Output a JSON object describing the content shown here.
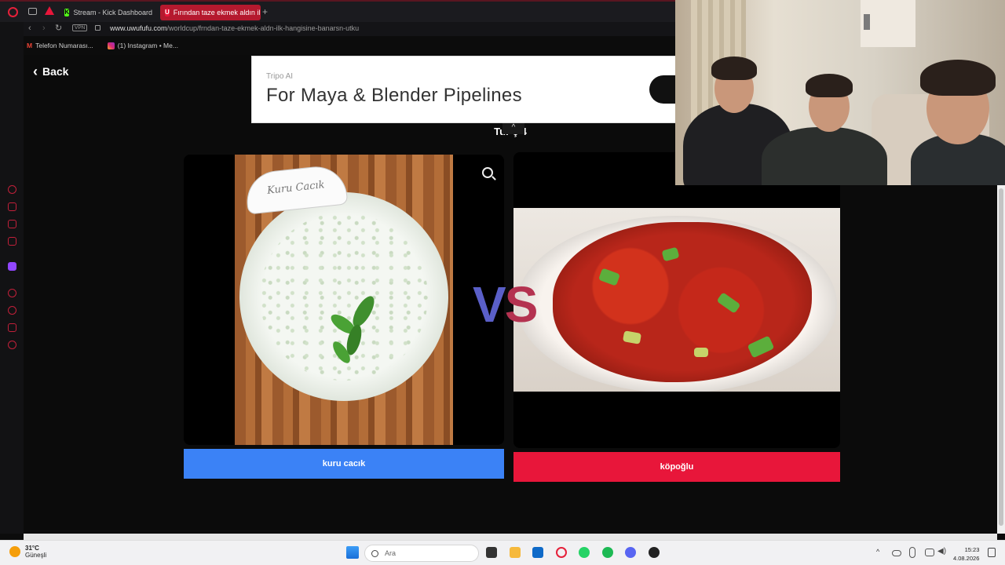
{
  "browser": {
    "tabs": [
      {
        "label": "Stream - Kick Dashboard",
        "icon": "K"
      },
      {
        "label": "Fırından taze ekmek aldın il",
        "icon": "U"
      }
    ],
    "new_tab": "+",
    "vpn_badge": "VPN",
    "url_host": "www.uwufufu.com",
    "url_path": "/worldcup/frndan-taze-ekmek-aldn-ilk-hangisine-banarsn-utku",
    "bookmarks": [
      {
        "label": "Telefon Numarası...",
        "icon": "M"
      },
      {
        "label": "(1) Instagram • Me...",
        "icon": "ig"
      }
    ]
  },
  "page": {
    "back_label": "Back",
    "ad": {
      "brand": "Tripo AI",
      "title": "For Maya & Blender Pipelines",
      "collapse": "^"
    },
    "round_text": "Tur     ç 4",
    "vs": {
      "v": "V",
      "s": "S"
    },
    "left": {
      "image_caption": "Kuru Cacık",
      "button_label": "kuru cacık"
    },
    "right": {
      "button_label": "köpoğlu"
    }
  },
  "taskbar": {
    "weather_temp": "31°C",
    "weather_desc": "Güneşli",
    "search_placeholder": "Ara",
    "time": "15:23",
    "date": "4.08.2026"
  },
  "colors": {
    "left_button": "#3b82f6",
    "right_button": "#e8163a",
    "browser_accent": "#b5192e"
  }
}
